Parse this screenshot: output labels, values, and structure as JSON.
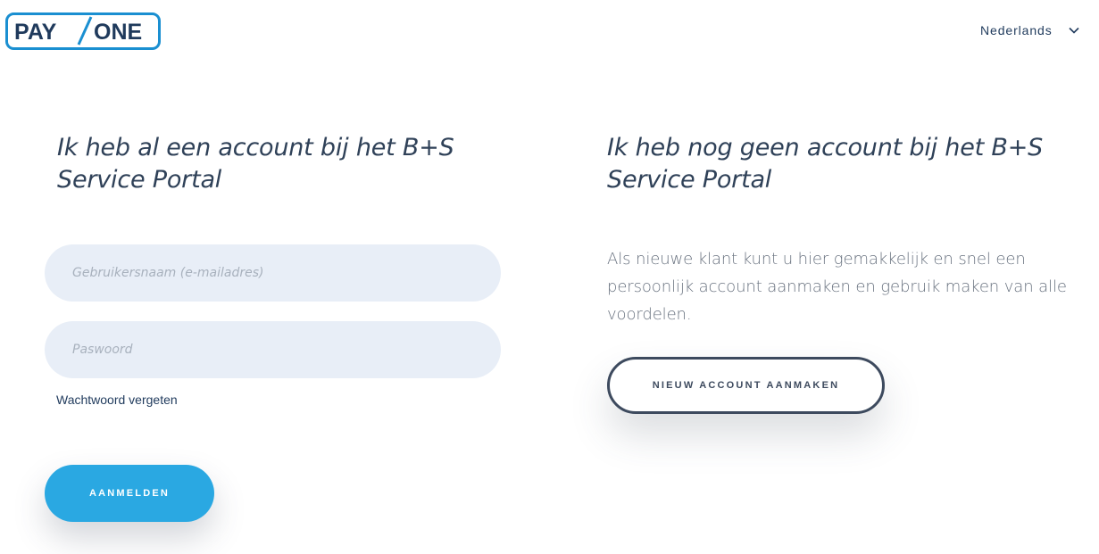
{
  "brand": {
    "logo_text_left": "PAY",
    "logo_text_right": "ONE",
    "logo_color": "#1a8fd1"
  },
  "header": {
    "language": "Nederlands"
  },
  "login": {
    "heading": "Ik heb al een account bij het B+S Service Portal",
    "username_placeholder": "Gebruikersnaam (e-mailadres)",
    "password_placeholder": "Paswoord",
    "forgot_password": "Wachtwoord vergeten",
    "submit_label": "AANMELDEN"
  },
  "register": {
    "heading": "Ik heb nog geen account bij het B+S Service Portal",
    "description": "Als nieuwe klant kunt u hier gemakkelijk en snel een persoonlijk account aanmaken en gebruik maken van alle voordelen.",
    "button_label": "NIEUW ACCOUNT AANMAKEN"
  },
  "colors": {
    "accent": "#2aa8e2",
    "input_bg": "#e8eef7",
    "dark": "#3d4a5e"
  }
}
